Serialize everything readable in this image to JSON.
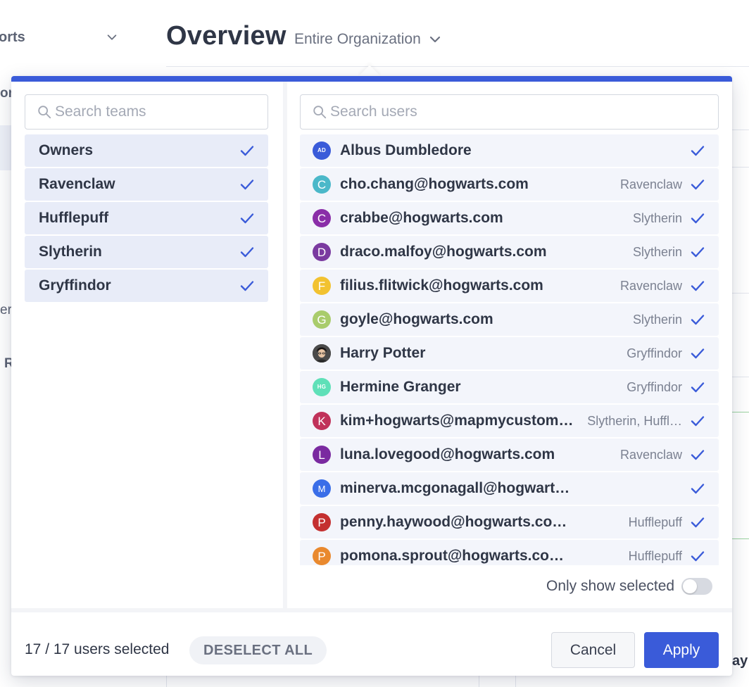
{
  "colors": {
    "accent": "#3a5bd9",
    "selected_team_bg": "#e8ecf8",
    "user_row_bg": "#f3f5fb",
    "check": "#3a5bd9"
  },
  "background": {
    "sidebar_label": "orts",
    "sidebar_fragments": [
      "ort",
      "er",
      "R"
    ],
    "page_title": "Overview",
    "scope_selector": "Entire Organization",
    "right_fragment": "ay"
  },
  "filter": {
    "teams_search_placeholder": "Search teams",
    "users_search_placeholder": "Search users",
    "teams": [
      {
        "label": "Owners",
        "selected": true
      },
      {
        "label": "Ravenclaw",
        "selected": true
      },
      {
        "label": "Hufflepuff",
        "selected": true
      },
      {
        "label": "Slytherin",
        "selected": true
      },
      {
        "label": "Gryffindor",
        "selected": true
      }
    ],
    "users": [
      {
        "name": "Albus Dumbledore",
        "team": "",
        "avatar": "AD",
        "avatar_color": "#3a5bd9",
        "avatar_style": "small"
      },
      {
        "name": "cho.chang@hogwarts.com",
        "team": "Ravenclaw",
        "avatar": "C",
        "avatar_color": "#4bb8c9",
        "avatar_style": "letter"
      },
      {
        "name": "crabbe@hogwarts.com",
        "team": "Slytherin",
        "avatar": "C",
        "avatar_color": "#8a2ea8",
        "avatar_style": "letter"
      },
      {
        "name": "draco.malfoy@hogwarts.com",
        "team": "Slytherin",
        "avatar": "D",
        "avatar_color": "#7a3aa0",
        "avatar_style": "letter"
      },
      {
        "name": "filius.flitwick@hogwarts.com",
        "team": "Ravenclaw",
        "avatar": "F",
        "avatar_color": "#f2c230",
        "avatar_style": "letter"
      },
      {
        "name": "goyle@hogwarts.com",
        "team": "Slytherin",
        "avatar": "G",
        "avatar_color": "#a9cc6c",
        "avatar_style": "letter"
      },
      {
        "name": "Harry Potter",
        "team": "Gryffindor",
        "avatar": "",
        "avatar_color": "#3b3b3b",
        "avatar_style": "photo"
      },
      {
        "name": "Hermine Granger",
        "team": "Gryffindor",
        "avatar": "HG",
        "avatar_color": "#5fe0b8",
        "avatar_style": "small"
      },
      {
        "name": "kim+hogwarts@mapmycustom…",
        "team": "Slytherin, Huffl…",
        "avatar": "K",
        "avatar_color": "#c0325a",
        "avatar_style": "letter"
      },
      {
        "name": "luna.lovegood@hogwarts.com",
        "team": "Ravenclaw",
        "avatar": "L",
        "avatar_color": "#7a2aa0",
        "avatar_style": "letter"
      },
      {
        "name": "minerva.mcgonagall@hogwart…",
        "team": "",
        "avatar": "M",
        "avatar_color": "#3a6ee8",
        "avatar_style": "small-letter"
      },
      {
        "name": "penny.haywood@hogwarts.co…",
        "team": "Hufflepuff",
        "avatar": "P",
        "avatar_color": "#c43030",
        "avatar_style": "letter"
      },
      {
        "name": "pomona.sprout@hogwarts.co…",
        "team": "Hufflepuff",
        "avatar": "P",
        "avatar_color": "#e9892e",
        "avatar_style": "letter"
      }
    ],
    "only_show_selected_label": "Only show selected",
    "only_show_selected": false,
    "selection_count": "17 / 17 users selected",
    "deselect_all_label": "DESELECT ALL",
    "cancel_label": "Cancel",
    "apply_label": "Apply"
  }
}
